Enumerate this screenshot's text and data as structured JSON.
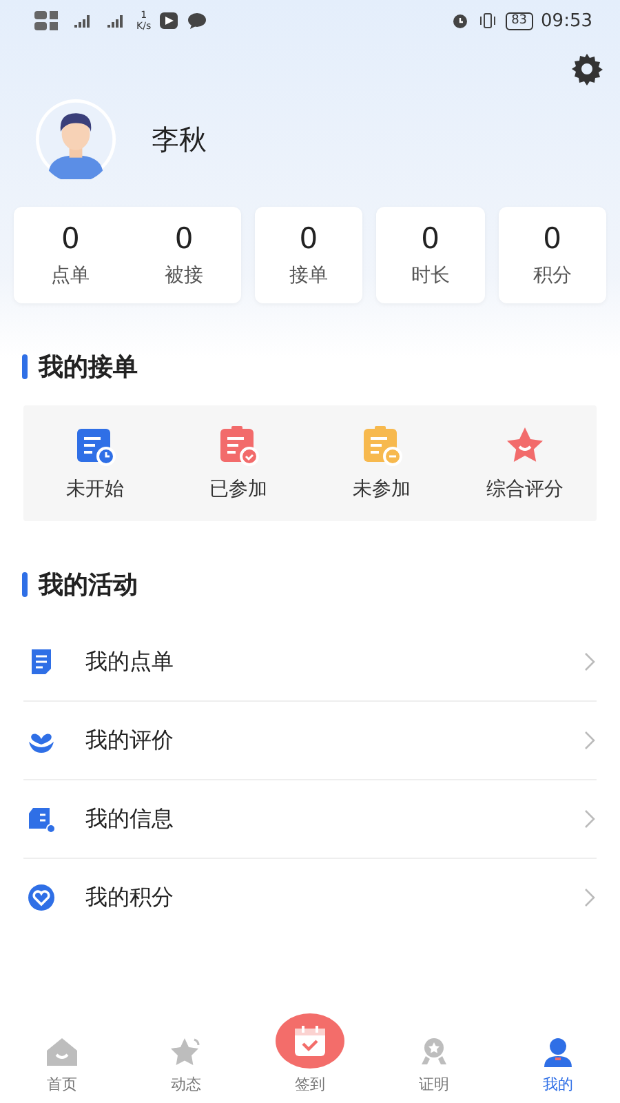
{
  "status_bar": {
    "speed_value": "1",
    "speed_unit": "K/s",
    "battery": "83",
    "time": "09:53"
  },
  "profile": {
    "name": "李秋"
  },
  "stat_cards": [
    {
      "stats": [
        {
          "value": "0",
          "label": "点单"
        },
        {
          "value": "0",
          "label": "被接"
        }
      ]
    },
    {
      "stats": [
        {
          "value": "0",
          "label": "接单"
        }
      ]
    },
    {
      "stats": [
        {
          "value": "0",
          "label": "时长"
        }
      ]
    },
    {
      "stats": [
        {
          "value": "0",
          "label": "积分"
        }
      ]
    }
  ],
  "orders_section": {
    "title": "我的接单",
    "items": [
      {
        "kind": "pending",
        "label": "未开始",
        "color": "#2f6fe6"
      },
      {
        "kind": "joined",
        "label": "已参加",
        "color": "#f26b6b"
      },
      {
        "kind": "missed",
        "label": "未参加",
        "color": "#f7b94e"
      },
      {
        "kind": "rating",
        "label": "综合评分",
        "color": "#f26b6b"
      }
    ]
  },
  "activity_section": {
    "title": "我的活动",
    "items": [
      {
        "kind": "doc",
        "label": "我的点单"
      },
      {
        "kind": "flower",
        "label": "我的评价"
      },
      {
        "kind": "card",
        "label": "我的信息"
      },
      {
        "kind": "heart",
        "label": "我的积分"
      }
    ]
  },
  "tab_bar": [
    {
      "kind": "home",
      "label": "首页",
      "selected": false
    },
    {
      "kind": "star",
      "label": "动态",
      "selected": false
    },
    {
      "kind": "checkin",
      "label": "签到",
      "selected": false
    },
    {
      "kind": "badge",
      "label": "证明",
      "selected": false
    },
    {
      "kind": "person",
      "label": "我的",
      "selected": true
    }
  ]
}
